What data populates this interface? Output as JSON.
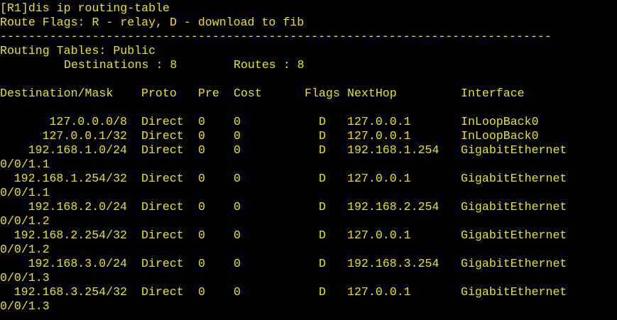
{
  "terminal": {
    "command_line": "[R1]dis ip routing-table",
    "route_flags_line": "Route Flags: R - relay, D - download to fib",
    "separator": "------------------------------------------------------------------------------",
    "routing_tables_line": "Routing Tables: Public",
    "destinations_label": "Destinations : 8",
    "routes_label": "Routes : 8",
    "headers": {
      "destination_mask": "Destination/Mask",
      "proto": "Proto",
      "pre": "Pre",
      "cost": "Cost",
      "flags": "Flags",
      "nexthop": "NextHop",
      "interface": "Interface"
    },
    "routes": [
      {
        "destination": "127.0.0.0/8",
        "proto": "Direct",
        "pre": "0",
        "cost": "0",
        "flags": "D",
        "nexthop": "127.0.0.1",
        "interface": "InLoopBack0",
        "interface_cont": ""
      },
      {
        "destination": "127.0.0.1/32",
        "proto": "Direct",
        "pre": "0",
        "cost": "0",
        "flags": "D",
        "nexthop": "127.0.0.1",
        "interface": "InLoopBack0",
        "interface_cont": ""
      },
      {
        "destination": "192.168.1.0/24",
        "proto": "Direct",
        "pre": "0",
        "cost": "0",
        "flags": "D",
        "nexthop": "192.168.1.254",
        "interface": "GigabitEthernet",
        "interface_cont": "0/0/1.1"
      },
      {
        "destination": "192.168.1.254/32",
        "proto": "Direct",
        "pre": "0",
        "cost": "0",
        "flags": "D",
        "nexthop": "127.0.0.1",
        "interface": "GigabitEthernet",
        "interface_cont": "0/0/1.1"
      },
      {
        "destination": "192.168.2.0/24",
        "proto": "Direct",
        "pre": "0",
        "cost": "0",
        "flags": "D",
        "nexthop": "192.168.2.254",
        "interface": "GigabitEthernet",
        "interface_cont": "0/0/1.2"
      },
      {
        "destination": "192.168.2.254/32",
        "proto": "Direct",
        "pre": "0",
        "cost": "0",
        "flags": "D",
        "nexthop": "127.0.0.1",
        "interface": "GigabitEthernet",
        "interface_cont": "0/0/1.2"
      },
      {
        "destination": "192.168.3.0/24",
        "proto": "Direct",
        "pre": "0",
        "cost": "0",
        "flags": "D",
        "nexthop": "192.168.3.254",
        "interface": "GigabitEthernet",
        "interface_cont": "0/0/1.3"
      },
      {
        "destination": "192.168.3.254/32",
        "proto": "Direct",
        "pre": "0",
        "cost": "0",
        "flags": "D",
        "nexthop": "127.0.0.1",
        "interface": "GigabitEthernet",
        "interface_cont": "0/0/1.3"
      }
    ]
  },
  "colors": {
    "background": "#000000",
    "text": "#e6e600"
  }
}
